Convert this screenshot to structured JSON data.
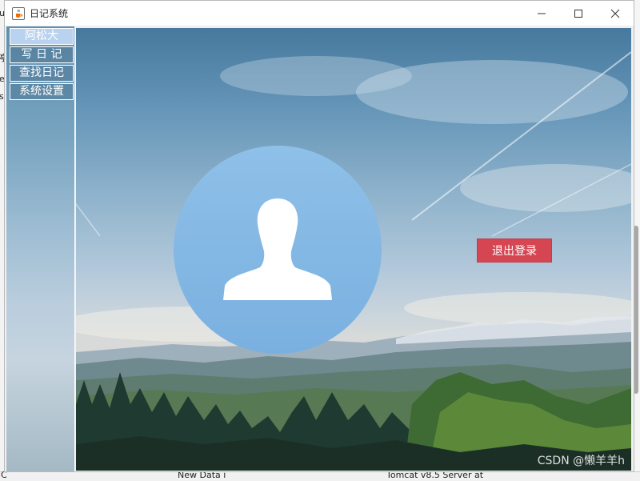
{
  "window": {
    "title": "日记系统",
    "app_icon": "java-cup-icon",
    "controls": [
      "minimize-icon",
      "maximize-icon",
      "close-icon"
    ]
  },
  "menu": {
    "items": [
      {
        "label": "阿松大",
        "kind": "user"
      },
      {
        "label": "写 日 记",
        "kind": "action"
      },
      {
        "label": "查找日记",
        "kind": "action"
      },
      {
        "label": "系统设置",
        "kind": "action"
      }
    ]
  },
  "main": {
    "avatar_icon": "user-silhouette-icon",
    "logout_label": "退出登录"
  },
  "watermark": "CSDN @懒羊羊h",
  "background_ide": {
    "left_fragments": [
      "u",
      "亭",
      "e",
      "st"
    ],
    "bottom_left": "C",
    "bottom_mid": "New Data i",
    "bottom_right": "Tomcat v8.5 Server at"
  },
  "colors": {
    "logout_button": "#d64652",
    "avatar_circle": "#80b6e4",
    "menu_user_item": "#b9d2ef"
  }
}
